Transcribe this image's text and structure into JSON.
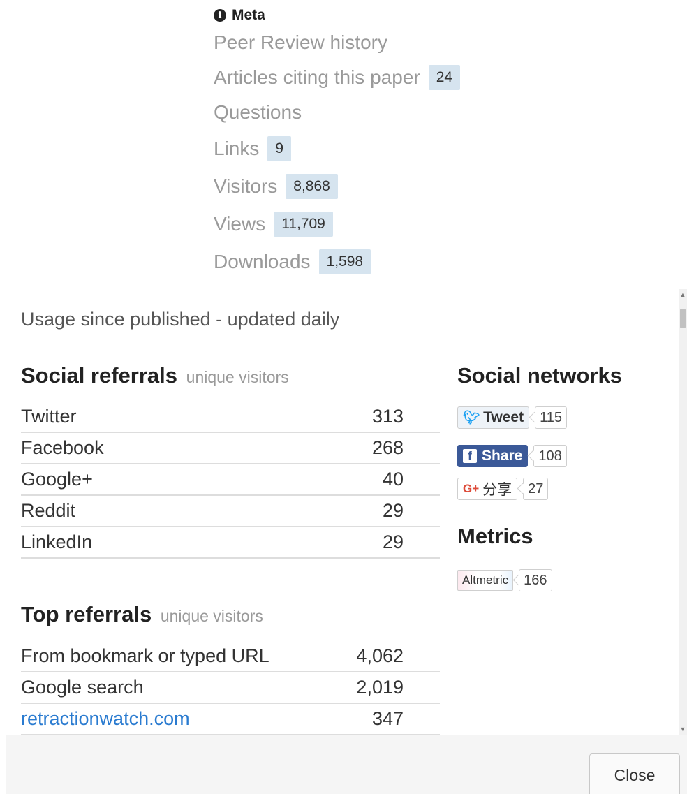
{
  "meta": {
    "heading": "Meta",
    "items": [
      {
        "label": "Peer Review history",
        "count": null
      },
      {
        "label": "Articles citing this paper",
        "count": "24"
      },
      {
        "label": "Questions",
        "count": null
      },
      {
        "label": "Links",
        "count": "9"
      },
      {
        "label": "Visitors",
        "count": "8,868"
      },
      {
        "label": "Views",
        "count": "11,709"
      },
      {
        "label": "Downloads",
        "count": "1,598"
      }
    ]
  },
  "usage": {
    "note": "Usage since published - updated daily"
  },
  "social_referrals": {
    "title": "Social referrals",
    "subtitle": "unique visitors",
    "rows": [
      {
        "source": "Twitter",
        "visitors": "313"
      },
      {
        "source": "Facebook",
        "visitors": "268"
      },
      {
        "source": "Google+",
        "visitors": "40"
      },
      {
        "source": "Reddit",
        "visitors": "29"
      },
      {
        "source": "LinkedIn",
        "visitors": "29"
      }
    ]
  },
  "top_referrals": {
    "title": "Top referrals",
    "subtitle": "unique visitors",
    "rows": [
      {
        "source": "From bookmark or typed URL",
        "visitors": "4,062"
      },
      {
        "source": "Google search",
        "visitors": "2,019"
      },
      {
        "source": "retractionwatch.com",
        "visitors": "347"
      }
    ]
  },
  "social_networks": {
    "title": "Social networks",
    "tweet": {
      "label": "Tweet",
      "count": "115"
    },
    "share": {
      "label": "Share",
      "count": "108"
    },
    "gplus": {
      "label": "分享",
      "count": "27"
    }
  },
  "metrics": {
    "title": "Metrics",
    "altmetric": {
      "label": "Altmetric",
      "score": "166"
    }
  },
  "footer": {
    "close_label": "Close"
  },
  "colors": {
    "badge_bg": "#d6e4ef",
    "link": "#2a7bd0",
    "facebook": "#3b5998",
    "twitter": "#1da1f2",
    "gplus": "#dd4b39"
  }
}
